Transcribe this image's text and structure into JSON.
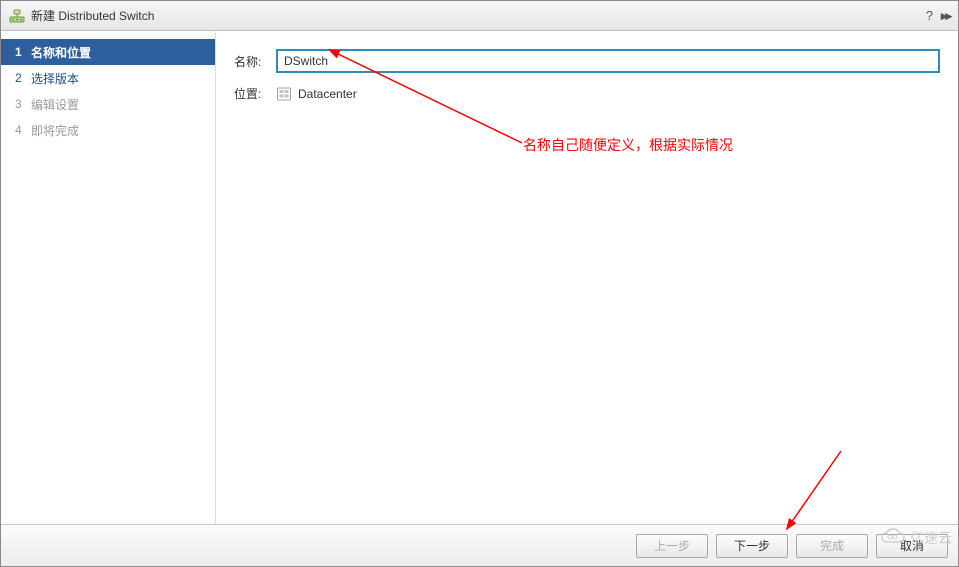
{
  "titlebar": {
    "title": "新建 Distributed Switch",
    "help_label": "?",
    "expand_label": "▸▸"
  },
  "sidebar": {
    "steps": [
      {
        "num": "1",
        "label": "名称和位置"
      },
      {
        "num": "2",
        "label": "选择版本"
      },
      {
        "num": "3",
        "label": "编辑设置"
      },
      {
        "num": "4",
        "label": "即将完成"
      }
    ]
  },
  "form": {
    "name_label": "名称:",
    "name_value": "DSwitch",
    "location_label": "位置:",
    "location_value": "Datacenter"
  },
  "annotations": {
    "name_hint": "名称自己随便定义，根据实际情况"
  },
  "footer": {
    "back_label": "上一步",
    "next_label": "下一步",
    "finish_label": "完成",
    "cancel_label": "取消"
  },
  "watermark": {
    "text": "亿速云"
  }
}
